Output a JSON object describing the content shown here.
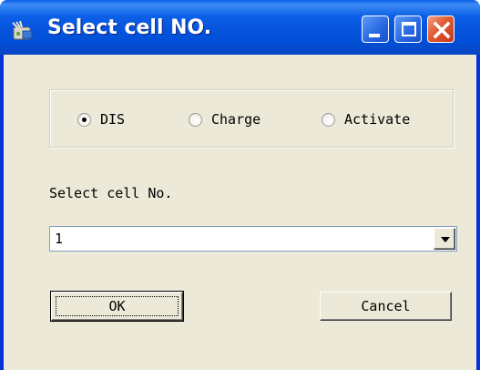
{
  "window": {
    "title": "Select cell NO.",
    "colors": {
      "titlebar": "#0553dc",
      "client": "#ece9d8",
      "close": "#e05a2e"
    }
  },
  "titlebar_buttons": [
    {
      "name": "minimize",
      "icon": "minimize-icon"
    },
    {
      "name": "maximize",
      "icon": "maximize-icon"
    },
    {
      "name": "close",
      "icon": "close-icon"
    }
  ],
  "mode_group": {
    "options": [
      {
        "label": "DIS",
        "selected": true
      },
      {
        "label": "Charge",
        "selected": false
      },
      {
        "label": "Activate",
        "selected": false
      }
    ]
  },
  "cell_select": {
    "label": "Select cell No.",
    "value": "1"
  },
  "buttons": {
    "ok_label": "OK",
    "cancel_label": "Cancel"
  }
}
